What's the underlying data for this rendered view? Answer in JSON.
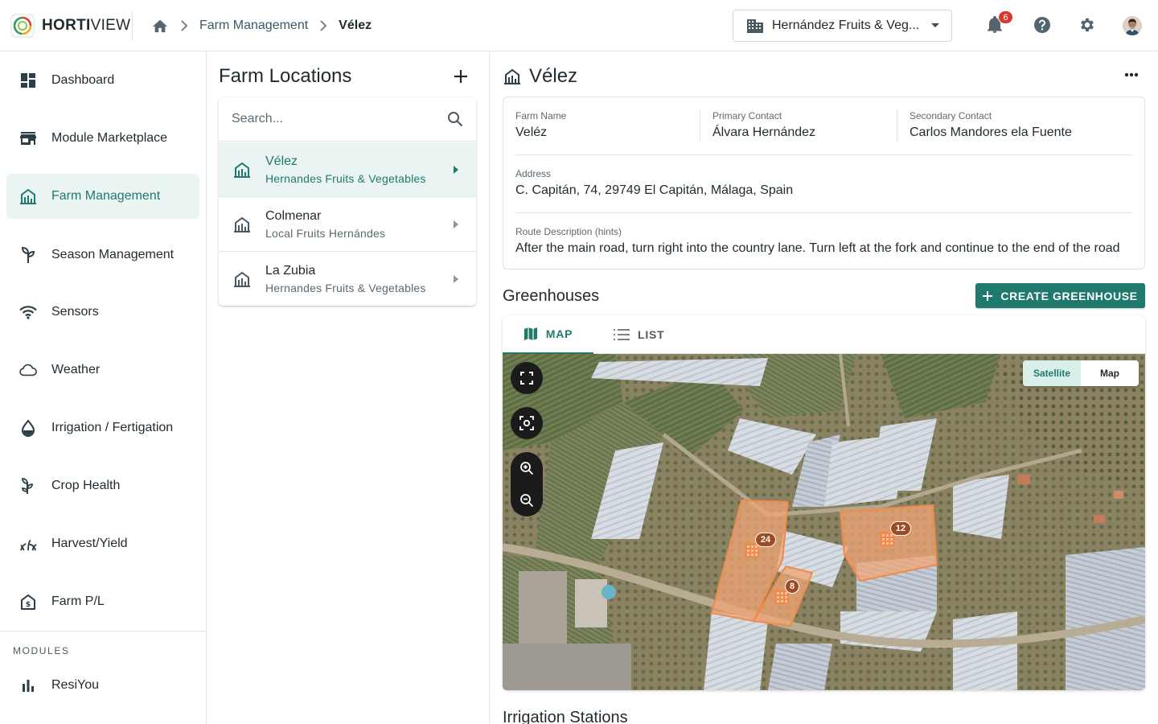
{
  "app": {
    "logo_brand_bold": "HORTI",
    "logo_brand_light": "VIEW"
  },
  "breadcrumb": {
    "section": "Farm Management",
    "current": "Vélez"
  },
  "org": {
    "selected": "Hernández Fruits & Veg..."
  },
  "notifications": {
    "count": "6"
  },
  "sidebar": {
    "items": [
      {
        "label": "Dashboard",
        "icon": "dashboard-icon"
      },
      {
        "label": "Module Marketplace",
        "icon": "store-icon"
      },
      {
        "label": "Farm Management",
        "icon": "farm-icon",
        "active": true
      },
      {
        "label": "Season Management",
        "icon": "sprout-icon"
      },
      {
        "label": "Sensors",
        "icon": "wifi-icon"
      },
      {
        "label": "Weather",
        "icon": "cloud-icon"
      },
      {
        "label": "Irrigation / Fertigation",
        "icon": "drop-icon"
      },
      {
        "label": "Crop Health",
        "icon": "plant-icon"
      },
      {
        "label": "Harvest/Yield",
        "icon": "grass-icon"
      },
      {
        "label": "Farm P/L",
        "icon": "house-money-icon"
      }
    ],
    "modules_label": "MODULES",
    "modules": [
      {
        "label": "ResiYou",
        "icon": "bar-chart-icon"
      }
    ]
  },
  "farm_list": {
    "title": "Farm Locations",
    "search_placeholder": "Search...",
    "farms": [
      {
        "name": "Vélez",
        "company": "Hernandes Fruits & Vegetables",
        "active": true
      },
      {
        "name": "Colmenar",
        "company": "Local Fruits Hernándes"
      },
      {
        "name": "La Zubia",
        "company": "Hernandes Fruits & Vegetables"
      }
    ]
  },
  "detail": {
    "title": "Vélez",
    "farm_name_label": "Farm Name",
    "farm_name": "Veléz",
    "primary_contact_label": "Primary Contact",
    "primary_contact": "Álvara Hernández",
    "secondary_contact_label": "Secondary Contact",
    "secondary_contact": "Carlos Mandores ela Fuente",
    "address_label": "Address",
    "address": "C. Capitán, 74, 29749 El Capitán, Málaga, Spain",
    "route_label": "Route Description (hints)",
    "route": "After the main road, turn right into the country lane. Turn left at the fork and continue to the end of the road"
  },
  "greenhouses": {
    "title": "Greenhouses",
    "create_label": "CREATE GREENHOUSE",
    "tabs": [
      {
        "label": "MAP",
        "active": true
      },
      {
        "label": "LIST"
      }
    ],
    "map_toggle": {
      "satellite": "Satellite",
      "map": "Map",
      "selected": "Satellite"
    },
    "markers": [
      {
        "count": "24"
      },
      {
        "count": "8"
      },
      {
        "count": "12"
      }
    ]
  },
  "irrigation": {
    "title": "Irrigation Stations"
  },
  "colors": {
    "accent": "#1f7a6d",
    "active_bg": "#eaf4f2",
    "badge": "#d83a2f",
    "plot_outline": "#f08a4b"
  }
}
